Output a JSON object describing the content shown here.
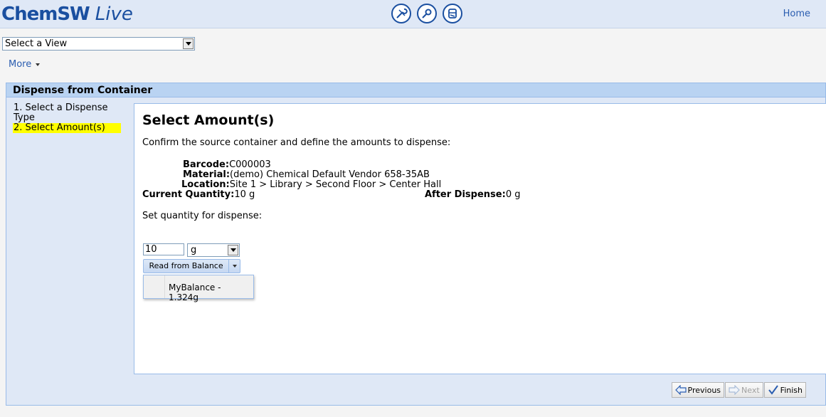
{
  "header": {
    "logo_main": "ChemSW",
    "logo_live": "Live",
    "icons": [
      "tools-icon",
      "search-key-icon",
      "container-icon"
    ],
    "home_label": "Home"
  },
  "view": {
    "select_value": "Select a View",
    "more_label": "More"
  },
  "wizard": {
    "title": "Dispense from Container",
    "steps": [
      "1. Select a Dispense Type",
      "2. Select Amount(s)"
    ],
    "active_step": 1,
    "heading": "Select Amount(s)",
    "instructions": "Confirm the source container and define the amounts to dispense:",
    "fields": {
      "barcode_label": "Barcode:",
      "barcode_value": "C000003",
      "material_label": "Material:",
      "material_value": "(demo) Chemical Default Vendor 658-35AB",
      "location_label": "Location:",
      "location_value": "Site 1 > Library > Second Floor > Center Hall",
      "current_qty_label": "Current Quantity:",
      "current_qty_value": "10 g",
      "after_dispense_label": "After Dispense:",
      "after_dispense_value": "0 g"
    },
    "set_qty_label": "Set quantity for dispense:",
    "quantity_value": "10",
    "unit_value": "g",
    "balance_button_label": "Read from Balance",
    "balance_menu_items": [
      "MyBalance - 1.324g"
    ]
  },
  "footer": {
    "previous_label": "Previous",
    "next_label": "Next",
    "finish_label": "Finish"
  },
  "colors": {
    "brand": "#1a4fa0",
    "panel_bg": "#dfe8f6",
    "title_bar": "#b9d3f2",
    "highlight": "#ffff00",
    "link": "#2a5db0"
  }
}
